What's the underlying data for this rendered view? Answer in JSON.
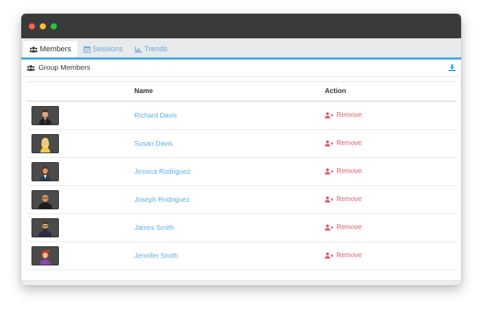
{
  "window": {
    "controls": {
      "close_color": "#ff5f57",
      "minimize_color": "#febc2e",
      "zoom_color": "#28c840"
    }
  },
  "tabs": [
    {
      "label": "Members",
      "icon": "users-icon",
      "active": true
    },
    {
      "label": "Sessions",
      "icon": "calendar-icon",
      "active": false
    },
    {
      "label": "Trends",
      "icon": "chart-icon",
      "active": false
    }
  ],
  "panel": {
    "title": "Group Members",
    "title_icon": "users-icon",
    "download_icon": "download-icon"
  },
  "table": {
    "columns": {
      "avatar": "",
      "name": "Name",
      "action": "Action"
    },
    "rows": [
      {
        "name": "Richard Davis",
        "action": "Remove",
        "avatar": "man-suit-avatar"
      },
      {
        "name": "Susan Davis",
        "action": "Remove",
        "avatar": "woman-blonde-avatar"
      },
      {
        "name": "Jessica Rodriguez",
        "action": "Remove",
        "avatar": "woman-brunette-avatar"
      },
      {
        "name": "Joseph Rodriguez",
        "action": "Remove",
        "avatar": "man-bald-avatar"
      },
      {
        "name": "James Smith",
        "action": "Remove",
        "avatar": "man-beard-avatar"
      },
      {
        "name": "Jennifer Smith",
        "action": "Remove",
        "avatar": "woman-redhair-avatar"
      }
    ]
  },
  "colors": {
    "accent": "#36a5e3",
    "link": "#5aaee3",
    "danger": "#e05a6a",
    "titlebar": "#3a3a3a"
  }
}
